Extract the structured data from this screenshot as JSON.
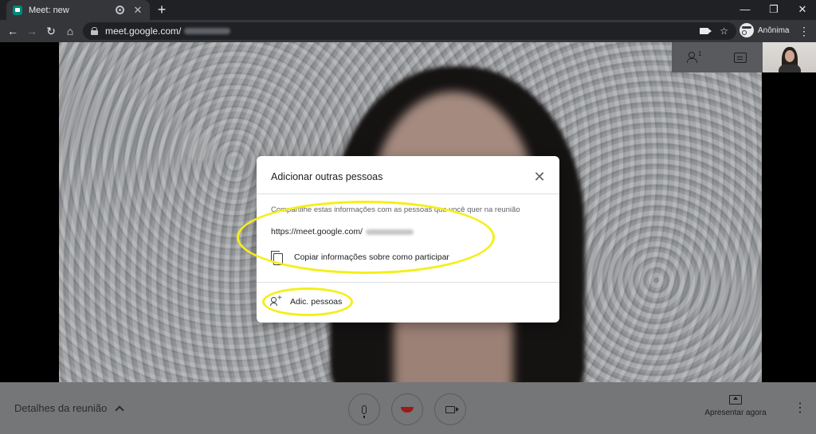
{
  "browser": {
    "tab_title": "Meet: new",
    "tab_close": "✕",
    "new_tab": "+",
    "window_controls": {
      "minimize": "—",
      "restore": "❐",
      "close": "✕"
    },
    "url_host": "meet.google.com/",
    "profile_label": "Anônima",
    "menu": "⋮"
  },
  "meet": {
    "participants_count": "1",
    "dialog": {
      "title": "Adicionar outras pessoas",
      "close": "✕",
      "description": "Compartilhe estas informações com as pessoas que você quer na reunião",
      "url_prefix": "https://meet.google.com/",
      "copy_label": "Copiar informações sobre como participar",
      "add_label": "Adic. pessoas"
    },
    "bottom_bar": {
      "details_label": "Detalhes da reunião",
      "present_label": "Apresentar agora",
      "more": "⋮"
    }
  },
  "colors": {
    "annotation": "#f5ef17",
    "hangup": "#a31c1c",
    "meet_icon": "#00897b"
  }
}
